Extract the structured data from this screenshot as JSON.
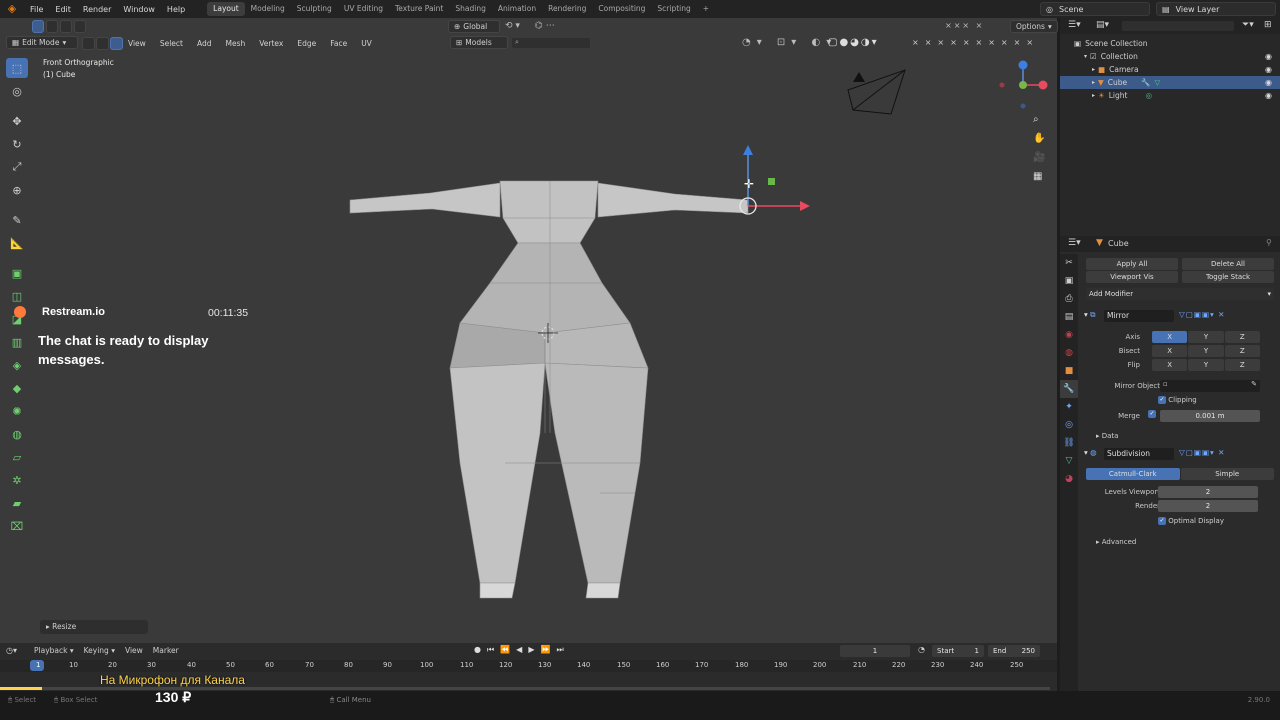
{
  "topbar": {
    "menus": [
      "File",
      "Edit",
      "Render",
      "Window",
      "Help"
    ],
    "workspaces": [
      "Layout",
      "Modeling",
      "Sculpting",
      "UV Editing",
      "Texture Paint",
      "Shading",
      "Animation",
      "Rendering",
      "Compositing",
      "Scripting"
    ],
    "active_workspace": "Layout",
    "add_tab": "+",
    "scene_label": "Scene",
    "view_layer_label": "View Layer"
  },
  "viewport_header": {
    "mode": "Edit Mode",
    "menus": [
      "View",
      "Select",
      "Add",
      "Mesh",
      "Vertex",
      "Edge",
      "Face",
      "UV"
    ],
    "transform_orientation": "Global",
    "snap_label": "Models",
    "options_label": "Options"
  },
  "viewport": {
    "view_name": "Front Orthographic",
    "object_label": "(1) Cube",
    "last_op": "Resize"
  },
  "chat_overlay": {
    "source": "Restream.io",
    "time": "00:11:35",
    "message": "The chat is ready to display messages."
  },
  "outliner": {
    "root": "Scene Collection",
    "items": [
      {
        "label": "Collection",
        "selected": false
      },
      {
        "label": "Camera",
        "selected": false
      },
      {
        "label": "Cube",
        "selected": true
      },
      {
        "label": "Light",
        "selected": false
      }
    ]
  },
  "properties": {
    "object_name": "Cube",
    "apply_all": "Apply All",
    "delete_all": "Delete All",
    "viewport_vis": "Viewport Vis",
    "toggle_stack": "Toggle Stack",
    "add_modifier": "Add Modifier",
    "mirror": {
      "name": "Mirror",
      "axis_label": "Axis",
      "bisect_label": "Bisect",
      "flip_label": "Flip",
      "axes": [
        "X",
        "Y",
        "Z"
      ],
      "mirror_object_label": "Mirror Object",
      "clipping_label": "Clipping",
      "merge_label": "Merge",
      "merge_value": "0.001 m",
      "data_label": "Data"
    },
    "subdivision": {
      "name": "Subdivision",
      "catmull_label": "Catmull-Clark",
      "simple_label": "Simple",
      "levels_viewport_label": "Levels Viewport",
      "levels_viewport_value": "2",
      "render_label": "Render",
      "render_value": "2",
      "optimal_display_label": "Optimal Display",
      "advanced_label": "Advanced"
    }
  },
  "timeline": {
    "menus": [
      "Playback",
      "Keying",
      "View",
      "Marker"
    ],
    "current_frame": "1",
    "start_label": "Start",
    "start_value": "1",
    "end_label": "End",
    "end_value": "250",
    "ruler": [
      "1",
      "10",
      "20",
      "30",
      "40",
      "50",
      "60",
      "70",
      "80",
      "90",
      "100",
      "110",
      "120",
      "130",
      "140",
      "150",
      "160",
      "170",
      "180",
      "190",
      "200",
      "210",
      "220",
      "230",
      "240",
      "250"
    ]
  },
  "donation": {
    "caption": "На Микрофон для Канала",
    "amount": "130 ₽",
    "progress": 0.04
  },
  "statusbar": {
    "select": "Select",
    "box_select": "Box Select",
    "call_menu": "Call Menu",
    "version": "2.90.0"
  }
}
